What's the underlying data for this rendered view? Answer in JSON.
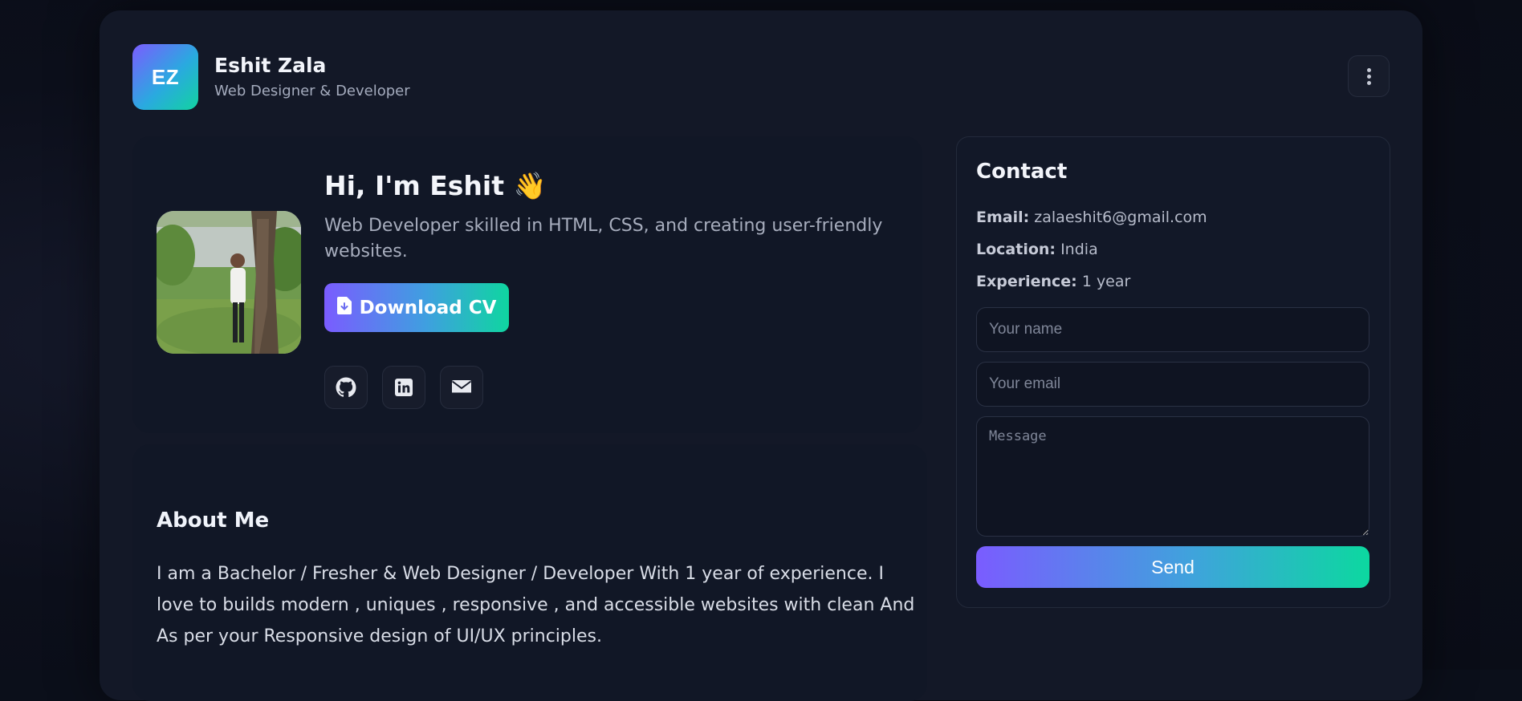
{
  "header": {
    "logo_initials": "EZ",
    "name": "Eshit Zala",
    "role": "Web Designer & Developer",
    "menu_icon": "more-vertical-icon"
  },
  "hero": {
    "title": "Hi, I'm Eshit 👋",
    "subtitle": "Web Developer skilled in HTML, CSS, and creating user-friendly websites.",
    "cv_button": "Download CV",
    "cv_icon": "file-download-icon",
    "socials": [
      {
        "icon": "github-icon"
      },
      {
        "icon": "linkedin-icon"
      },
      {
        "icon": "envelope-icon"
      }
    ]
  },
  "about": {
    "title": "About Me",
    "text": "I am a Bachelor / Fresher & Web Designer / Developer With 1 year of experience. I love to builds modern , uniques , responsive , and accessible websites with clean And As per your Responsive design of UI/UX principles."
  },
  "contact": {
    "title": "Contact",
    "email_label": "Email:",
    "email_value": "zalaeshit6@gmail.com",
    "location_label": "Location:",
    "location_value": "India",
    "experience_label": "Experience:",
    "experience_value": "1 year",
    "name_placeholder": "Your name",
    "email_placeholder": "Your email",
    "message_placeholder": "Message",
    "send_button": "Send"
  },
  "colors": {
    "accent_start": "#7a5cff",
    "accent_end": "#0fd6a0",
    "background": "#131827"
  }
}
